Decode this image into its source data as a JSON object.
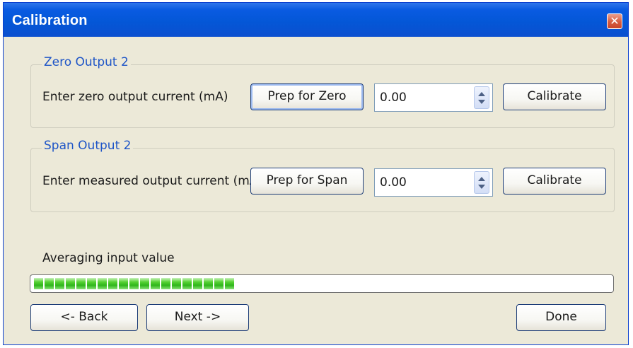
{
  "window": {
    "title": "Calibration",
    "close_icon": "close-icon",
    "close_glyph": "✕"
  },
  "zero_group": {
    "title": "Zero Output 2",
    "label": "Enter zero output current (mA)",
    "prep_button": "Prep for Zero",
    "value": "0.00",
    "calibrate_button": "Calibrate"
  },
  "span_group": {
    "title": "Span Output 2",
    "label": "Enter measured output current (mA)",
    "prep_button": "Prep for Span",
    "value": "0.00",
    "calibrate_button": "Calibrate"
  },
  "progress": {
    "label": "Averaging input value",
    "fraction": 0.35,
    "color": "#2fb61b"
  },
  "footer": {
    "back_button": "<- Back",
    "next_button": "Next ->",
    "done_button": "Done"
  },
  "colors": {
    "titlebar": "#0457d7",
    "dialog_background": "#ece9d8",
    "group_title": "#1e55c7"
  }
}
